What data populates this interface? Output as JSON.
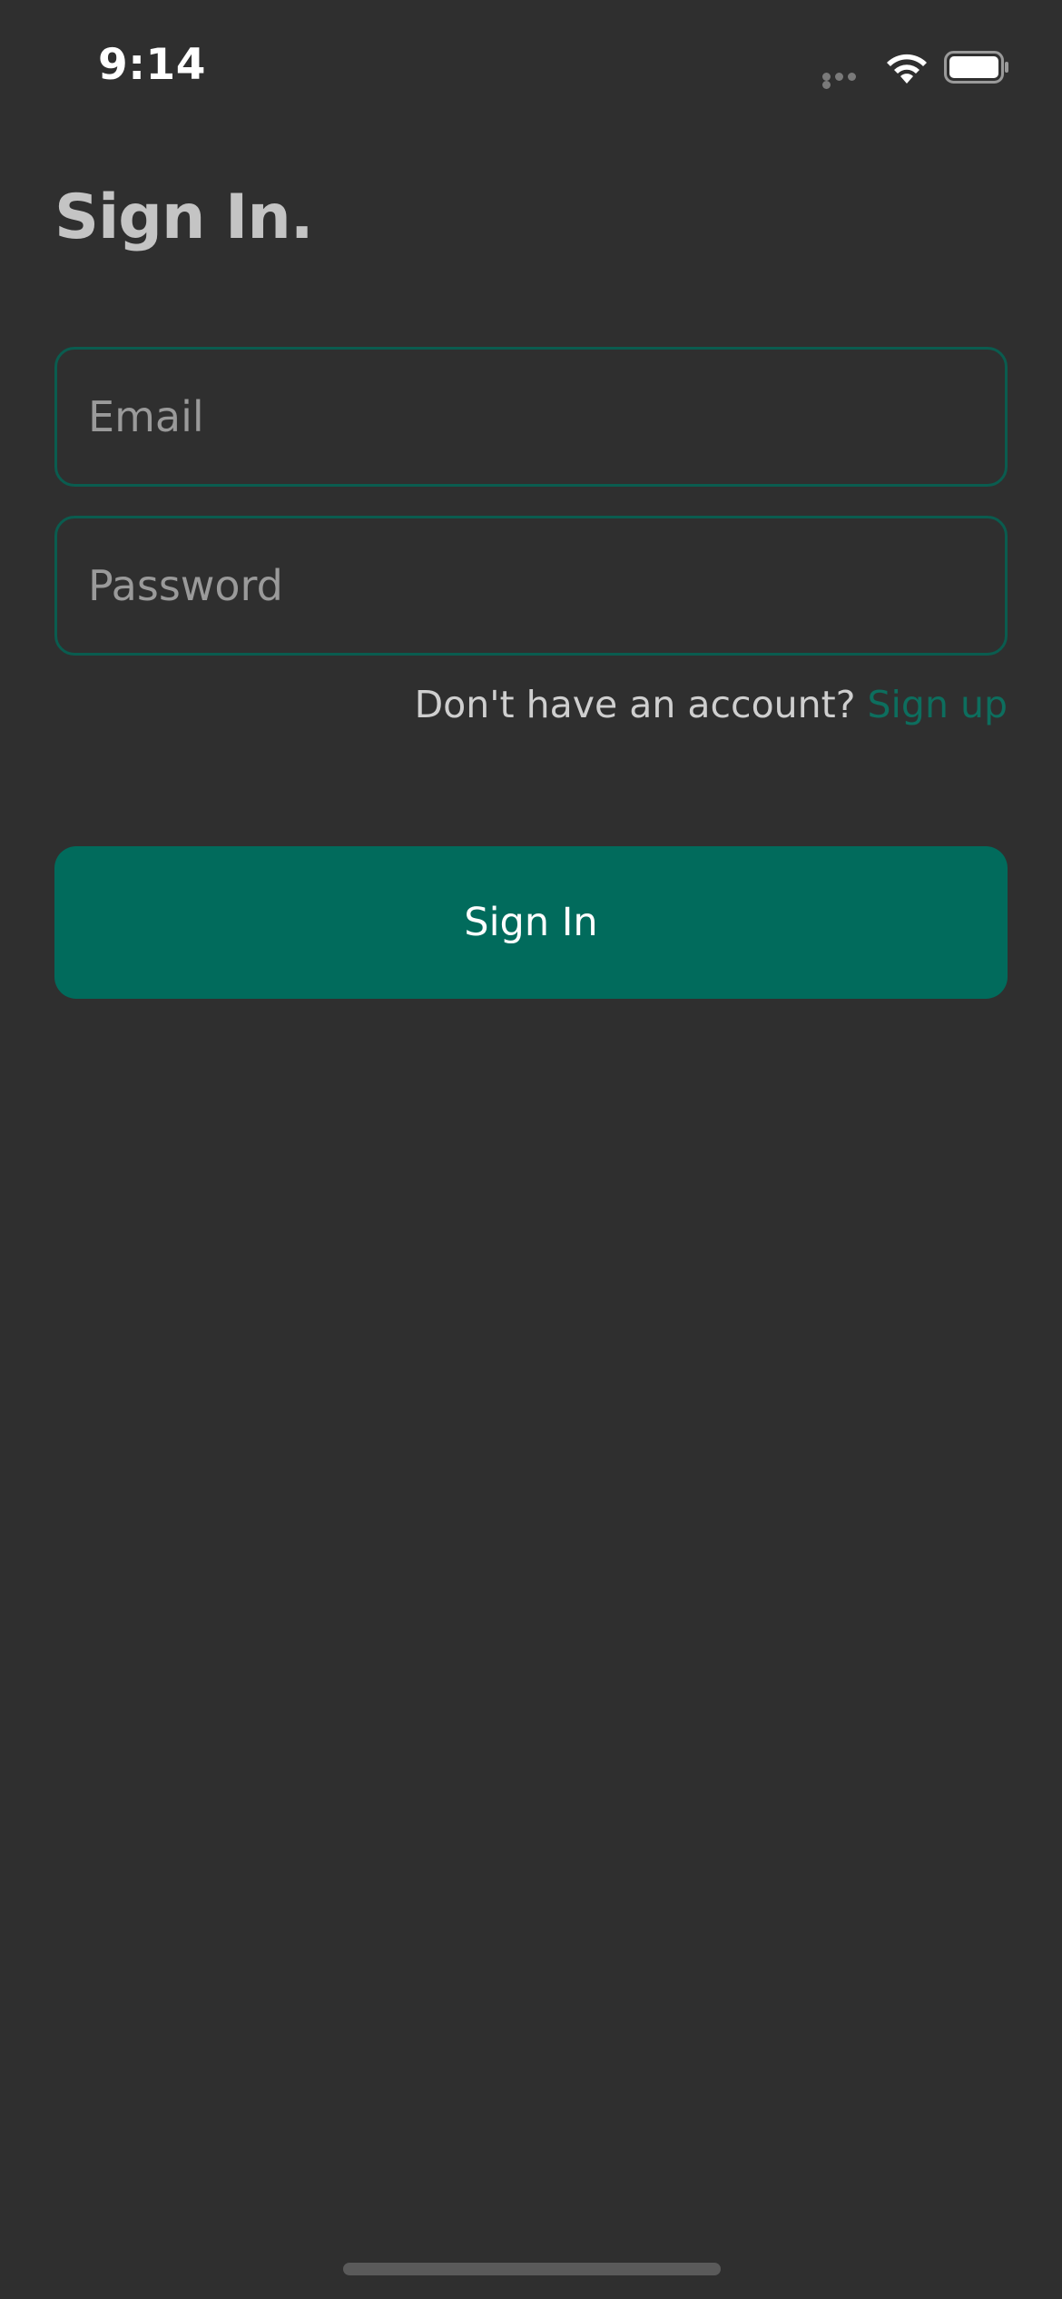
{
  "status_bar": {
    "time": "9:14",
    "icons": [
      "signal-dots-icon",
      "wifi-icon",
      "battery-icon"
    ]
  },
  "page": {
    "title": "Sign In."
  },
  "form": {
    "email_placeholder": "Email",
    "email_value": "",
    "password_placeholder": "Password",
    "password_value": "",
    "signup_prompt": "Don't have an account? ",
    "signup_link": "Sign up",
    "submit_label": "Sign In"
  },
  "colors": {
    "background": "#2f2f2f",
    "accent": "#016b5c",
    "field_border": "#0a5c4f",
    "link": "#0d6e5e",
    "title": "#c4c4c4"
  }
}
